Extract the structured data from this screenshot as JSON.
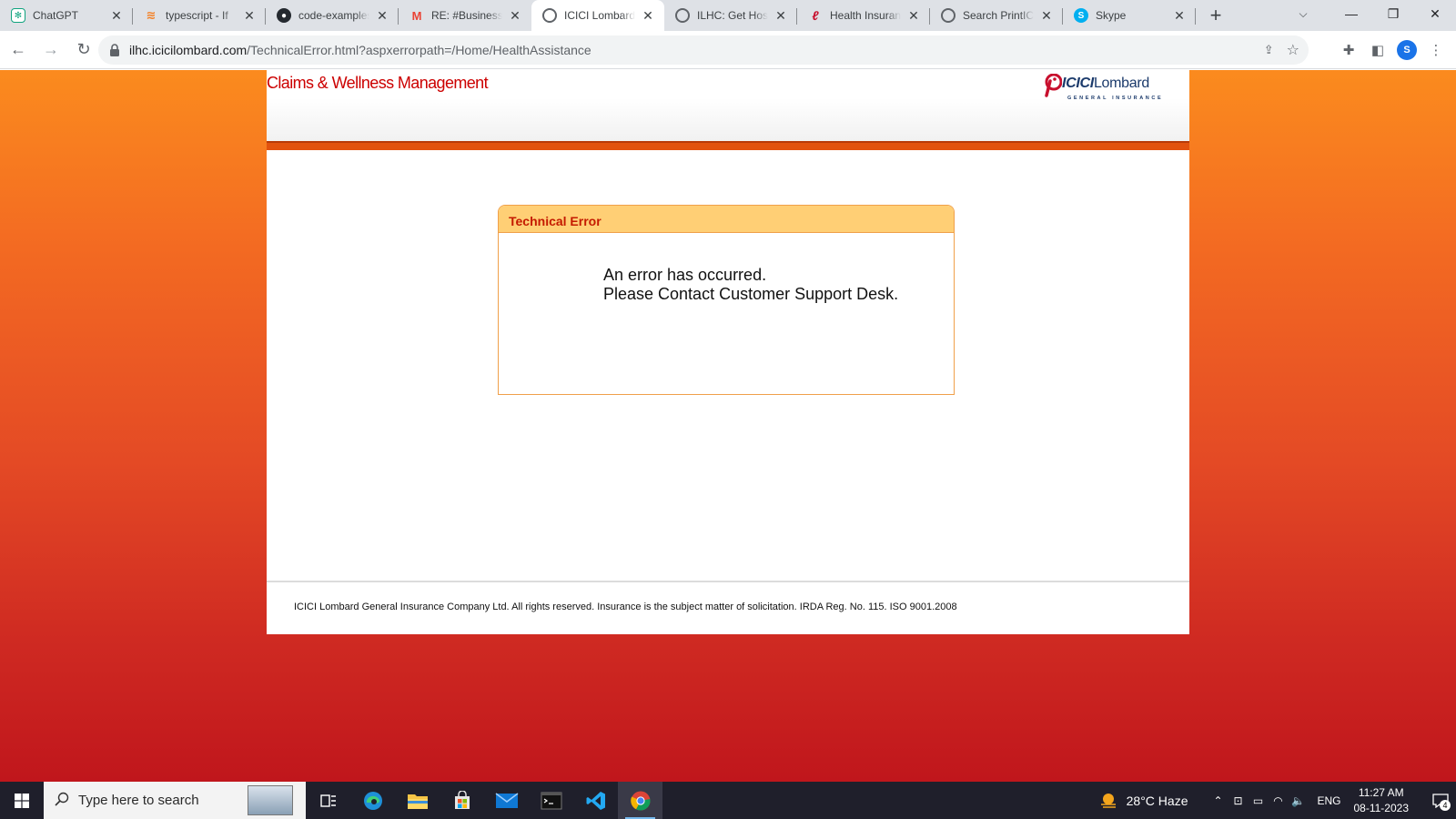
{
  "browser": {
    "tabs": [
      {
        "title": "ChatGPT",
        "icon": "chatgpt-icon",
        "active": false
      },
      {
        "title": "typescript - If ",
        "icon": "stackoverflow-icon",
        "active": false
      },
      {
        "title": "code-examples",
        "icon": "github-icon",
        "active": false
      },
      {
        "title": "RE: #Business#",
        "icon": "gmail-icon",
        "active": false
      },
      {
        "title": "ICICI Lombard",
        "icon": "globe-icon",
        "active": true
      },
      {
        "title": "ILHC: Get Hosp",
        "icon": "globe-icon",
        "active": false
      },
      {
        "title": "Health Insuran",
        "icon": "icici-icon",
        "active": false
      },
      {
        "title": "Search PrintIC",
        "icon": "globe-icon",
        "active": false
      },
      {
        "title": "Skype",
        "icon": "skype-icon",
        "active": false
      }
    ],
    "url_host": "ilhc.icicilombard.com",
    "url_path": "/TechnicalError.html?aspxerrorpath=/Home/HealthAssistance",
    "profile_initial": "S"
  },
  "page": {
    "app_title": "Claims & Wellness Management",
    "logo": {
      "brand_main": "ICICI",
      "brand_secondary": "Lombard",
      "tagline": "GENERAL INSURANCE"
    },
    "error": {
      "heading": "Technical Error",
      "line1": "An error has occurred.",
      "line2": "Please Contact Customer Support Desk."
    },
    "footer": "ICICI Lombard General Insurance Company Ltd. All rights reserved. Insurance is the subject matter of solicitation. IRDA Reg. No. 115. ISO 9001.2008"
  },
  "taskbar": {
    "search_placeholder": "Type here to search",
    "weather": "28°C  Haze",
    "language": "ENG",
    "time": "11:27 AM",
    "date": "08-11-2023",
    "notification_count": "4"
  },
  "colors": {
    "accent_red": "#cc0000",
    "page_orange": "#f36a22",
    "error_header": "#ffcf75"
  }
}
